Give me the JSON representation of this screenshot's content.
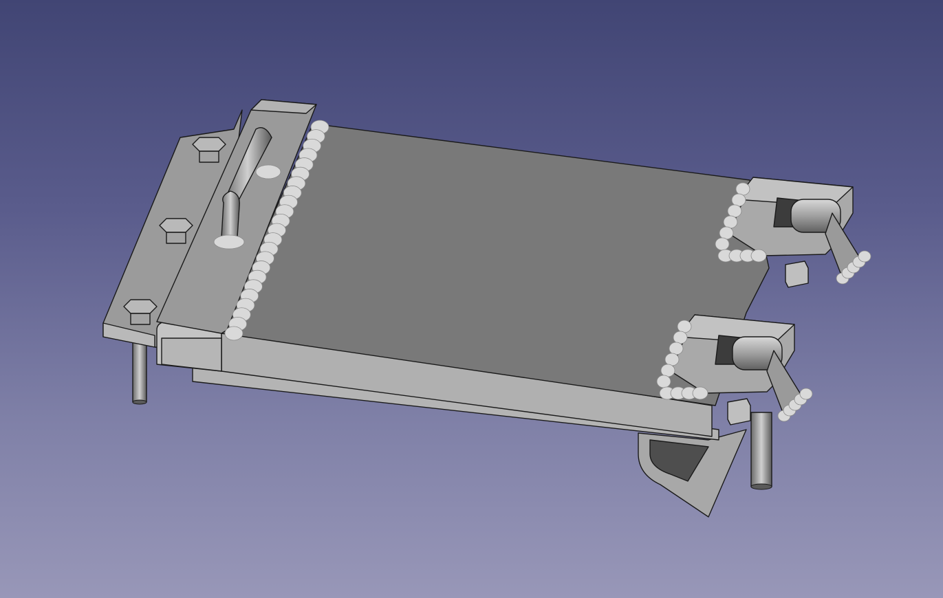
{
  "viewer": {
    "background_top": "#414574",
    "background_bottom": "#9897b8",
    "model_color": "#8a8a8a",
    "edge_color": "#1a1a1a"
  }
}
